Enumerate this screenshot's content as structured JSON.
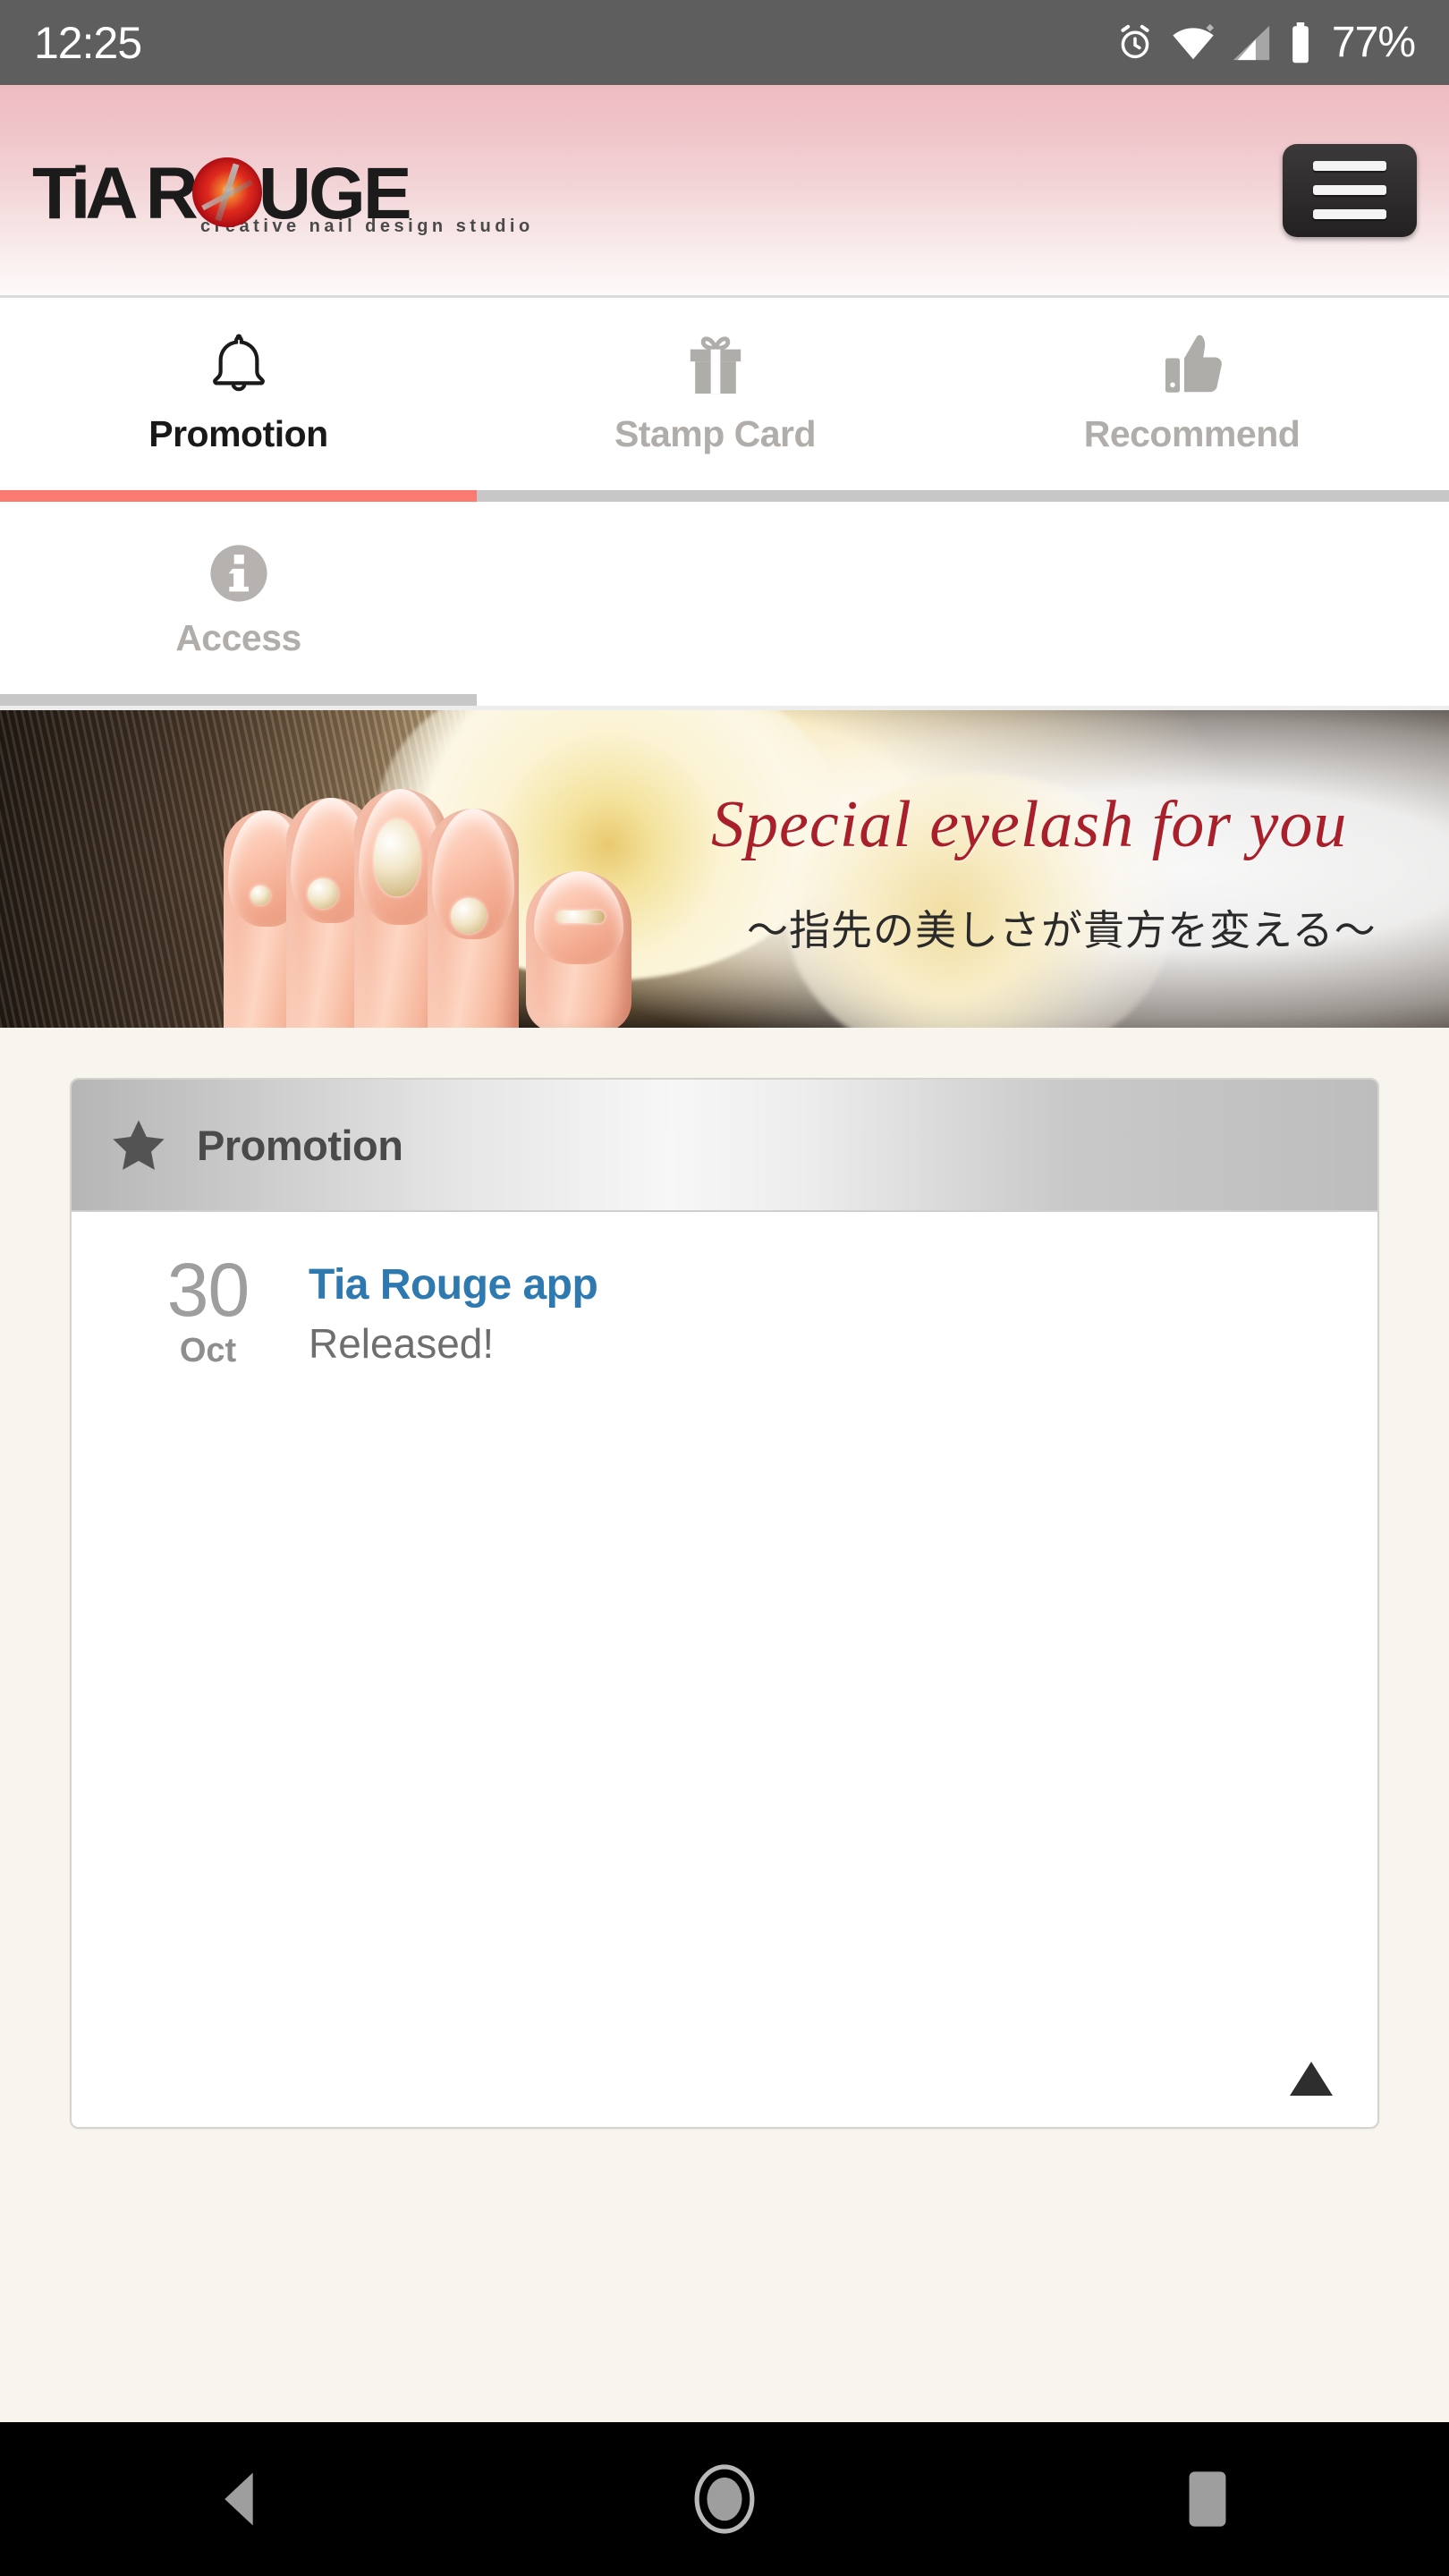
{
  "status_bar": {
    "time": "12:25",
    "battery_percent": "77%",
    "icons": [
      "alarm-icon",
      "wifi-icon",
      "cellular-signal-icon",
      "battery-icon"
    ]
  },
  "header": {
    "logo_part1": "TiA",
    "logo_part2": "R",
    "logo_gem": "O",
    "logo_part3": "UGE",
    "logo_tagline": "creative nail design studio",
    "menu_button": "menu-button",
    "gradient_top": "#EDBAC1",
    "gradient_bottom": "#FDFAFA"
  },
  "tabs": {
    "active_color": "#FA7A72",
    "inactive_color": "#C7C7C7",
    "items": [
      {
        "label": "Promotion",
        "icon": "bell-icon",
        "active": true
      },
      {
        "label": "Stamp Card",
        "icon": "gift-icon",
        "active": false
      },
      {
        "label": "Recommend",
        "icon": "thumbs-up-icon",
        "active": false
      },
      {
        "label": "Access",
        "icon": "info-icon",
        "active": false
      }
    ]
  },
  "hero": {
    "title": "Special eyelash for you",
    "subtitle": "〜指先の美しさが貴方を変える〜",
    "title_color": "#A9202A",
    "image_description": "nail-art-photo"
  },
  "promotion_card": {
    "header_title": "Promotion",
    "header_icon": "star-icon",
    "scroll_top_icon": "scroll-to-top-triangle-icon",
    "news": [
      {
        "day": "30",
        "month": "Oct",
        "title": "Tia Rouge app",
        "description": "Released!",
        "title_color": "#2E79AF"
      }
    ]
  },
  "android_nav": {
    "back": "back-button",
    "home": "home-button",
    "recents": "recents-button"
  }
}
